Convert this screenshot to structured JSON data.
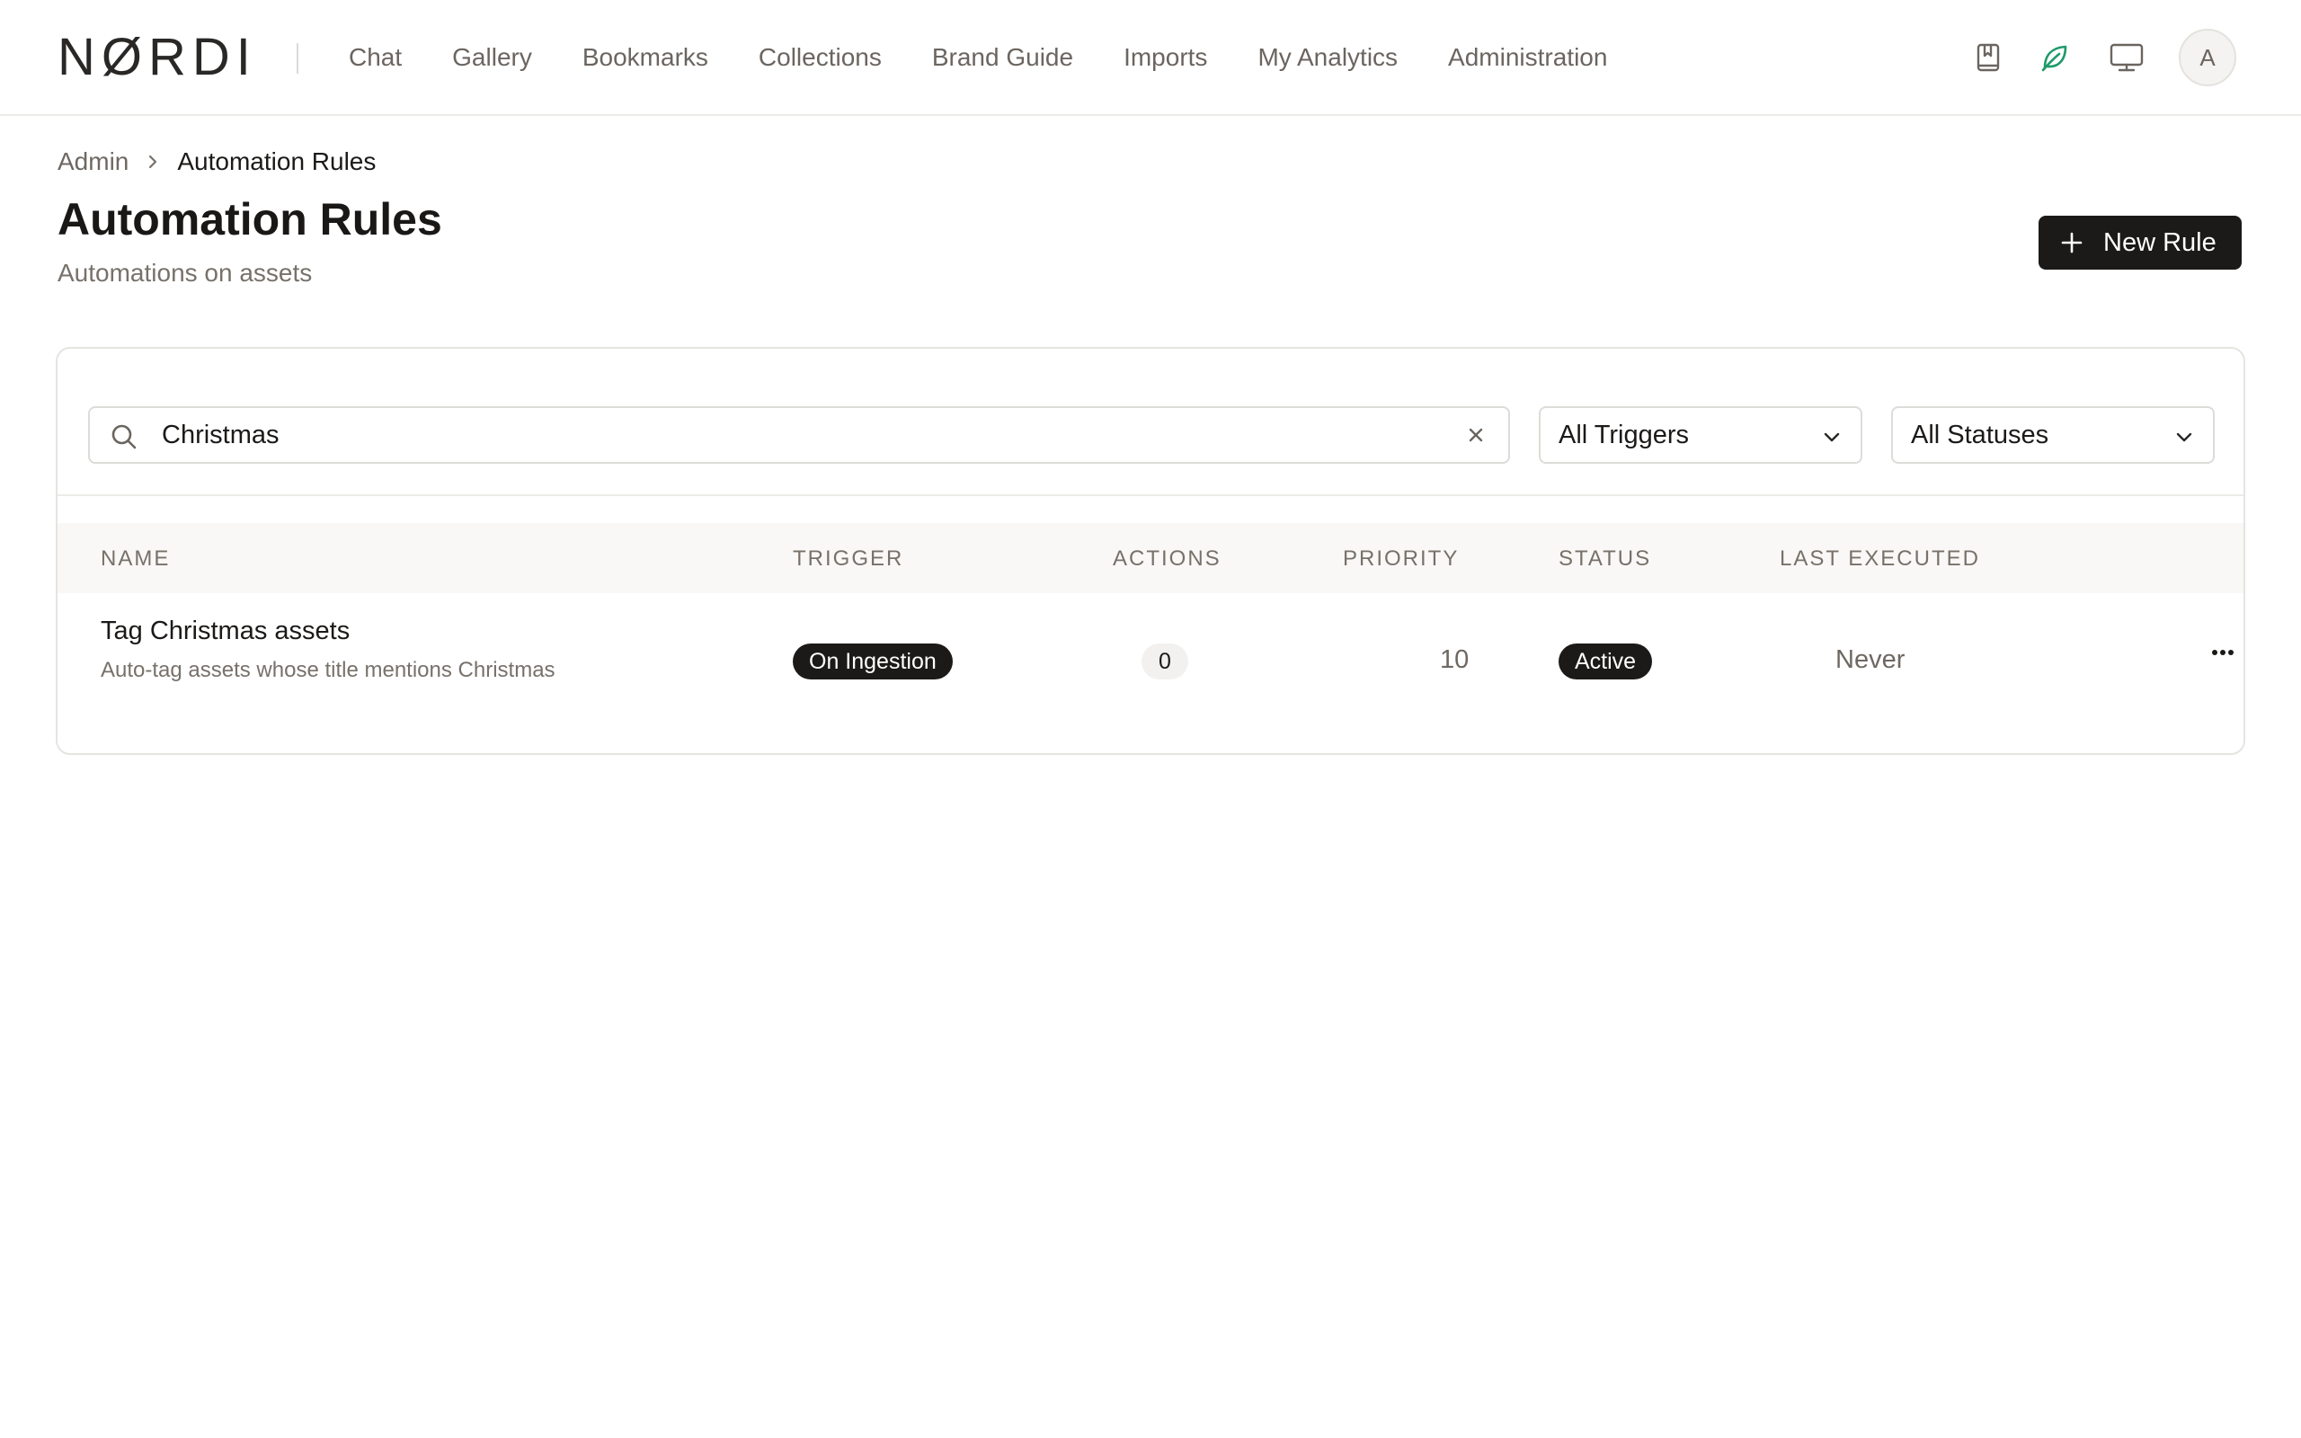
{
  "brand": {
    "logo_text": "NØRDI"
  },
  "nav": {
    "items": [
      {
        "label": "Chat"
      },
      {
        "label": "Gallery"
      },
      {
        "label": "Bookmarks"
      },
      {
        "label": "Collections"
      },
      {
        "label": "Brand Guide"
      },
      {
        "label": "Imports"
      },
      {
        "label": "My Analytics"
      },
      {
        "label": "Administration"
      }
    ]
  },
  "topbar_icons": [
    "bookmark-book-icon",
    "leaf-icon",
    "monitor-icon"
  ],
  "user": {
    "avatar_initial": "A"
  },
  "breadcrumb": {
    "parent": "Admin",
    "current": "Automation Rules"
  },
  "page": {
    "title": "Automation Rules",
    "subtitle": "Automations on assets",
    "new_button_label": "New Rule"
  },
  "filters": {
    "search_value": "Christmas",
    "trigger_select": "All Triggers",
    "status_select": "All Statuses"
  },
  "table": {
    "columns": [
      "NAME",
      "TRIGGER",
      "ACTIONS",
      "PRIORITY",
      "STATUS",
      "LAST EXECUTED"
    ],
    "rows": [
      {
        "name": "Tag Christmas assets",
        "description": "Auto-tag assets whose title mentions Christmas",
        "trigger": "On Ingestion",
        "actions": "0",
        "priority": "10",
        "status": "Active",
        "last_executed": "Never"
      }
    ]
  },
  "colors": {
    "accent_dark": "#1c1a18",
    "leaf_green": "#1f9a6a",
    "muted_text": "#77716a",
    "border": "#e6e4e0"
  }
}
